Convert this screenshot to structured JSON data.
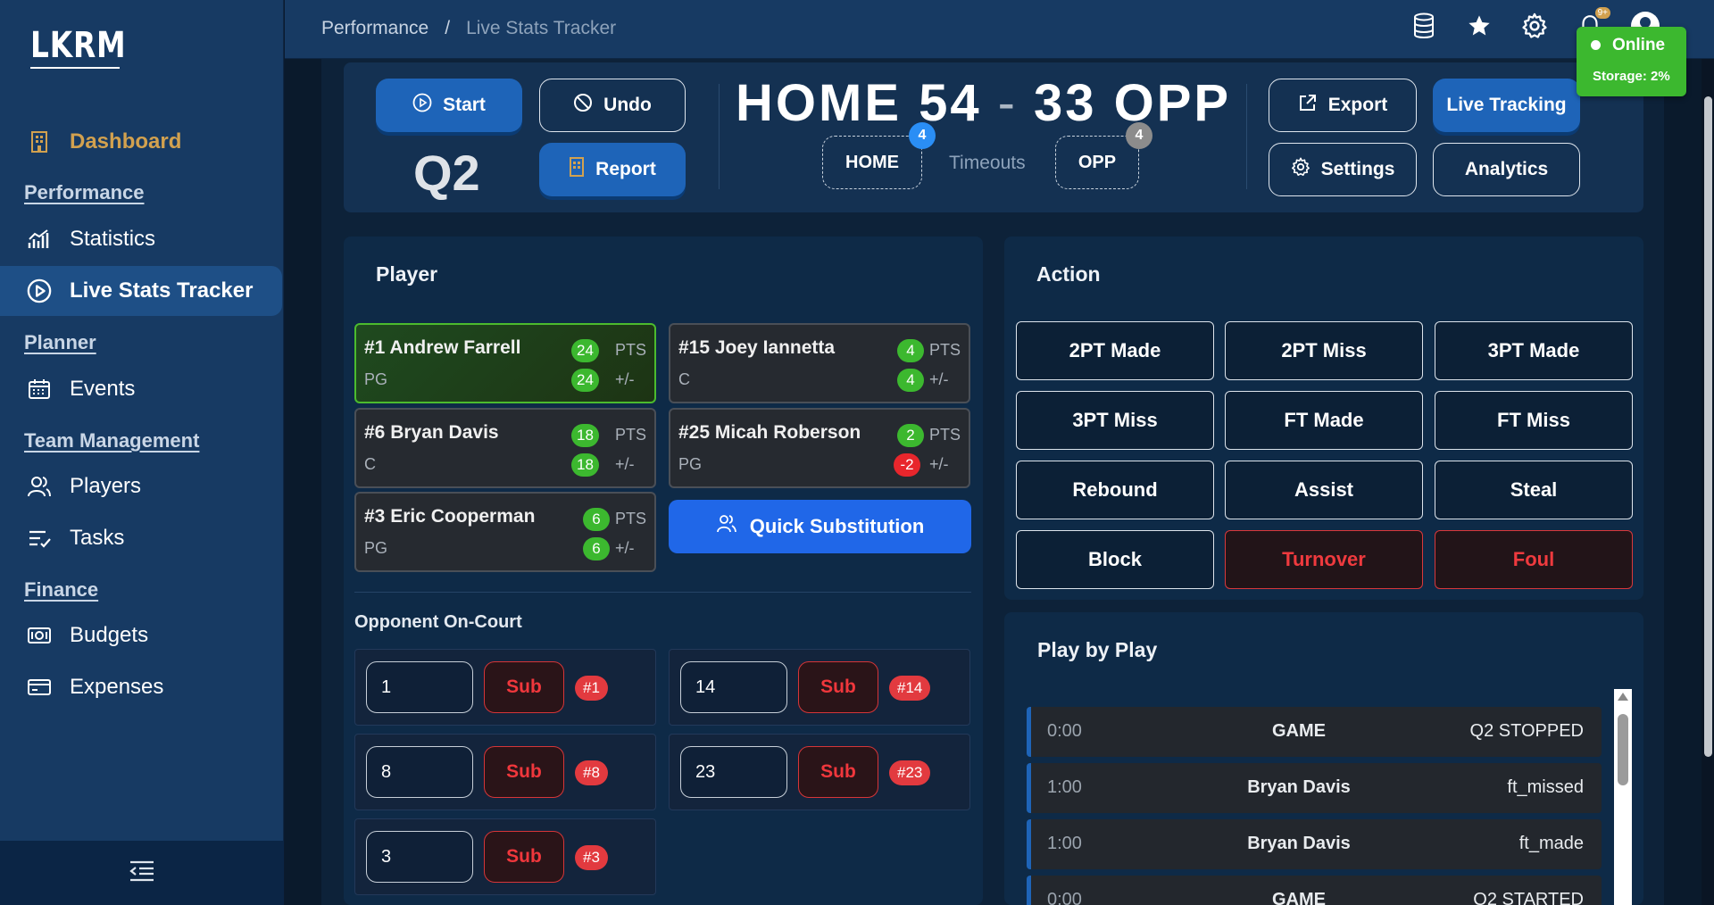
{
  "app": {
    "logo": "LKRM"
  },
  "sidebar": {
    "dashboard": "Dashboard",
    "sections": {
      "performance": "Performance",
      "planner": "Planner",
      "team_management": "Team Management",
      "finance": "Finance"
    },
    "items": {
      "statistics": "Statistics",
      "live_stats_tracker": "Live Stats Tracker",
      "events": "Events",
      "players": "Players",
      "tasks": "Tasks",
      "budgets": "Budgets",
      "expenses": "Expenses"
    }
  },
  "breadcrumb": {
    "parent": "Performance",
    "separator": "/",
    "current": "Live Stats Tracker"
  },
  "topbar": {
    "notification_badge": "9+"
  },
  "status": {
    "label": "Online",
    "storage": "Storage: 2%",
    "color": "#3cb82f"
  },
  "controls": {
    "start": "Start",
    "undo": "Undo",
    "report": "Report",
    "quarter": "Q2",
    "export": "Export",
    "live_tracking": "Live Tracking",
    "settings": "Settings",
    "analytics": "Analytics"
  },
  "score": {
    "home_label": "HOME",
    "home": "54",
    "separator": "-",
    "opp": "33",
    "opp_label": "OPP"
  },
  "timeouts": {
    "label": "Timeouts",
    "home_label": "HOME",
    "home_count": "4",
    "opp_label": "OPP",
    "opp_count": "4"
  },
  "player_panel": {
    "title": "Player",
    "pts_label": "PTS",
    "pm_label": "+/-",
    "players": [
      {
        "name": "#1 Andrew Farrell",
        "pos": "PG",
        "pts": "24",
        "pm": "24",
        "selected": true
      },
      {
        "name": "#15 Joey Iannetta",
        "pos": "C",
        "pts": "4",
        "pm": "4"
      },
      {
        "name": "#6 Bryan Davis",
        "pos": "C",
        "pts": "18",
        "pm": "18"
      },
      {
        "name": "#25 Micah Roberson",
        "pos": "PG",
        "pts": "2",
        "pm": "-2"
      },
      {
        "name": "#3 Eric Cooperman",
        "pos": "PG",
        "pts": "6",
        "pm": "6"
      }
    ],
    "quick_sub": "Quick Substitution",
    "opponent_title": "Opponent On-Court",
    "sub_label": "Sub",
    "opponents": [
      {
        "value": "1",
        "badge": "#1"
      },
      {
        "value": "14",
        "badge": "#14"
      },
      {
        "value": "8",
        "badge": "#8"
      },
      {
        "value": "23",
        "badge": "#23"
      },
      {
        "value": "3",
        "badge": "#3"
      }
    ]
  },
  "action_panel": {
    "title": "Action",
    "buttons": [
      "2PT Made",
      "2PT Miss",
      "3PT Made",
      "3PT Miss",
      "FT Made",
      "FT Miss",
      "Rebound",
      "Assist",
      "Steal",
      "Block",
      "Turnover",
      "Foul"
    ]
  },
  "pbp": {
    "title": "Play by Play",
    "rows": [
      {
        "time": "0:00",
        "who": "GAME",
        "event": "Q2 STOPPED"
      },
      {
        "time": "1:00",
        "who": "Bryan Davis",
        "event": "ft_missed"
      },
      {
        "time": "1:00",
        "who": "Bryan Davis",
        "event": "ft_made"
      },
      {
        "time": "0:00",
        "who": "GAME",
        "event": "Q2 STARTED"
      }
    ]
  }
}
